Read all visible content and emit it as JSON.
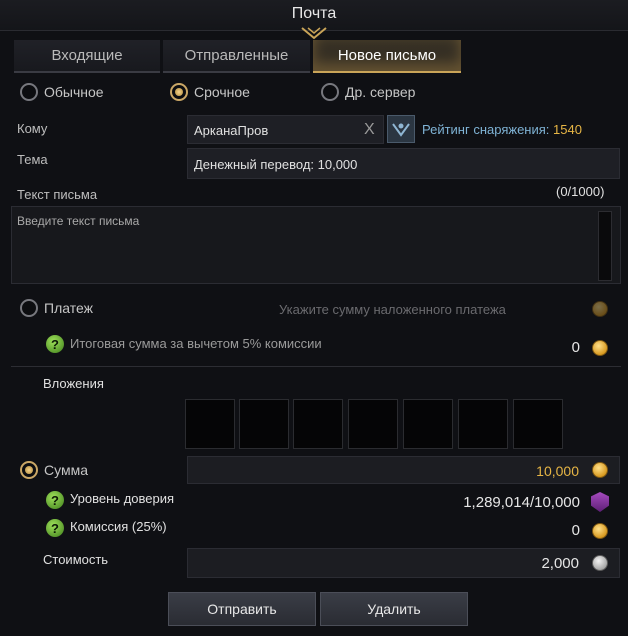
{
  "window": {
    "title": "Почта"
  },
  "tabs": [
    {
      "label": "Входящие"
    },
    {
      "label": "Отправленные"
    },
    {
      "label": "Новое письмо"
    }
  ],
  "mail_type": {
    "options": [
      {
        "label": "Обычное",
        "selected": false
      },
      {
        "label": "Срочное",
        "selected": true
      },
      {
        "label": "Др. сервер",
        "selected": false
      }
    ]
  },
  "recipient": {
    "label": "Кому",
    "value": "АрканаПров",
    "clear_glyph": "X",
    "gear_score_label": "Рейтинг снаряжения:",
    "gear_score_value": "1540"
  },
  "subject": {
    "label": "Тема",
    "value": "Денежный перевод: 10,000"
  },
  "body": {
    "label": "Текст письма",
    "counter": "(0/1000)",
    "placeholder": "Введите текст письма"
  },
  "cod": {
    "label": "Платеж",
    "placeholder": "Укажите сумму наложенного платежа",
    "net_label": "Итоговая сумма за вычетом 5% комиссии",
    "net_value": "0",
    "help_glyph": "?"
  },
  "attachments": {
    "label": "Вложения",
    "slot_count": 7
  },
  "money": {
    "label": "Сумма",
    "value": "10,000",
    "trust_label": "Уровень доверия",
    "trust_value": "1,289,014/10,000",
    "fee_label": "Комиссия (25%)",
    "fee_value": "0",
    "cost_label": "Стоимость",
    "cost_value": "2,000",
    "help_glyph": "?"
  },
  "actions": {
    "send_label": "Отправить",
    "delete_label": "Удалить"
  },
  "colors": {
    "accent_gold": "#e6b545",
    "score_blue": "#7fb3d5",
    "background": "#0f1014"
  },
  "icons": [
    "radio-icon",
    "close-icon",
    "gear-score-icon",
    "gold-coin-icon",
    "silver-coin-icon",
    "trust-shield-icon",
    "help-icon"
  ]
}
